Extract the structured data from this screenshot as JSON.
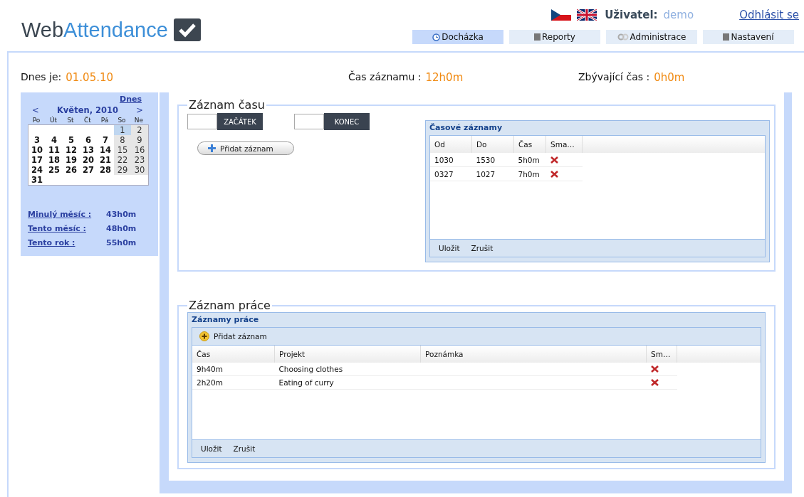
{
  "header": {
    "logo": {
      "part_1": "Web",
      "part_2": "Attendance"
    },
    "user_label": "Uživatel:",
    "user_name": "demo",
    "logout": "Odhlásit se"
  },
  "tabs": [
    {
      "label": "Docházka",
      "selected": true
    },
    {
      "label": "Reporty",
      "selected": false
    },
    {
      "label": "Administrace",
      "selected": false
    },
    {
      "label": "Nastavení",
      "selected": false
    }
  ],
  "summary": [
    {
      "label": "Dnes je:",
      "value": "01.05.10"
    },
    {
      "label": "Čas záznamu :",
      "value": "12h0m"
    },
    {
      "label": "Zbývající čas :",
      "value": "0h0m"
    }
  ],
  "calendar": {
    "today_link": "Dnes",
    "prev": "<",
    "month": "Květen, 2010",
    "next": ">",
    "weekdays": [
      "Po",
      "Út",
      "St",
      "Čt",
      "Pá",
      "So",
      "Ne"
    ],
    "weeks": [
      [
        {
          "day": "1",
          "selected": true
        },
        {
          "day": "2",
          "selected": false
        }
      ],
      [
        {
          "day": "3",
          "selected": false
        },
        {
          "day": "4",
          "selected": false
        },
        {
          "day": "5",
          "selected": false
        },
        {
          "day": "6",
          "selected": false
        },
        {
          "day": "7",
          "selected": false
        },
        {
          "day": "8",
          "selected": false
        },
        {
          "day": "9",
          "selected": false
        }
      ],
      [
        {
          "day": "10",
          "selected": false
        },
        {
          "day": "11",
          "selected": false
        },
        {
          "day": "12",
          "selected": false
        },
        {
          "day": "13",
          "selected": false
        },
        {
          "day": "14",
          "selected": false
        },
        {
          "day": "15",
          "selected": false
        },
        {
          "day": "16",
          "selected": false
        }
      ],
      [
        {
          "day": "17",
          "selected": false
        },
        {
          "day": "18",
          "selected": false
        },
        {
          "day": "19",
          "selected": false
        },
        {
          "day": "20",
          "selected": false
        },
        {
          "day": "21",
          "selected": false
        },
        {
          "day": "22",
          "selected": false
        },
        {
          "day": "23",
          "selected": false
        }
      ],
      [
        {
          "day": "24",
          "selected": false
        },
        {
          "day": "25",
          "selected": false
        },
        {
          "day": "26",
          "selected": false
        },
        {
          "day": "27",
          "selected": false
        },
        {
          "day": "28",
          "selected": false
        },
        {
          "day": "29",
          "selected": false
        },
        {
          "day": "30",
          "selected": false
        }
      ],
      [
        {
          "day": "31",
          "selected": false
        }
      ]
    ]
  },
  "totals": [
    {
      "label": "Minulý měsíc :",
      "value": "43h0m"
    },
    {
      "label": "Tento měsíc :",
      "value": "48h0m"
    },
    {
      "label": "Tento rok :",
      "value": "55h0m"
    }
  ],
  "time_record": {
    "title": "Záznam času",
    "start_button": "ZAČÁTEK",
    "end_button": "KONEC",
    "add_button": "Přidat záznam",
    "grid": {
      "title": "Časové záznamy",
      "columns": [
        "Od",
        "Do",
        "Čas",
        "Sma…"
      ],
      "rows": [
        [
          "1030",
          "1530",
          "5h0m"
        ],
        [
          "0327",
          "1027",
          "7h0m"
        ]
      ],
      "buttons": [
        "Uložit",
        "Zrušit"
      ]
    }
  },
  "work_record": {
    "title": "Záznam práce",
    "grid": {
      "title": "Záznamy práce",
      "add_button": "Přidat záznam",
      "columns": [
        "Čas",
        "Projekt",
        "Poznámka",
        "Sm…"
      ],
      "rows": [
        [
          "9h40m",
          "Choosing clothes",
          ""
        ],
        [
          "2h20m",
          "Eating of curry",
          ""
        ]
      ],
      "buttons": [
        "Uložit",
        "Zrušit"
      ]
    }
  }
}
